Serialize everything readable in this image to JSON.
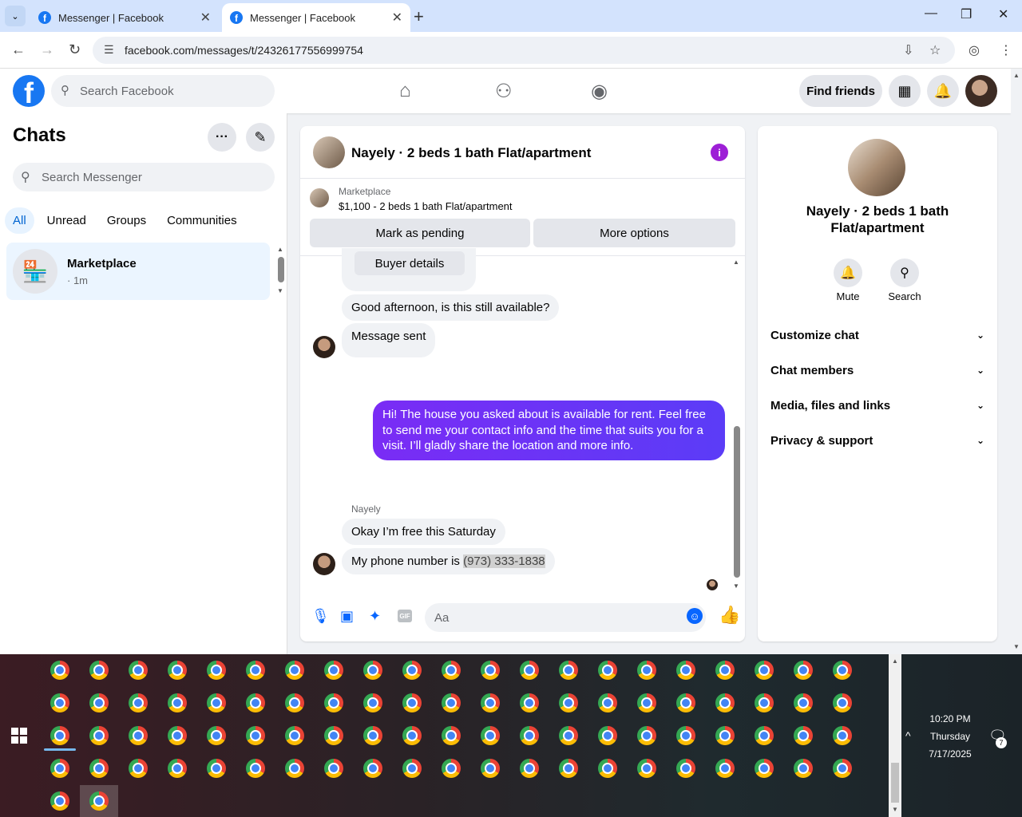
{
  "browser": {
    "tabs": [
      {
        "title": "Messenger | Facebook"
      },
      {
        "title": "Messenger | Facebook"
      }
    ],
    "url": "facebook.com/messages/t/24326177556999754"
  },
  "header": {
    "search_placeholder": "Search Facebook",
    "find_friends": "Find friends"
  },
  "chats": {
    "title": "Chats",
    "search_placeholder": "Search Messenger",
    "filters": [
      "All",
      "Unread",
      "Groups",
      "Communities"
    ],
    "conversations": [
      {
        "name": "Marketplace",
        "time": "· 1m"
      }
    ]
  },
  "conversation": {
    "name": "Nayely · 2 beds 1 bath Flat/apartment",
    "marketplace_label": "Marketplace",
    "listing": "$1,100 - 2 beds 1 bath Flat/apartment",
    "mark_pending": "Mark as pending",
    "more_options": "More options",
    "buyer_details": "Buyer details",
    "messages": {
      "m1": "Good afternoon, is this still available?",
      "m2": "Message sent",
      "out1": "Hi! The house you asked about is available for rent. Feel free to send me your contact info and the time that suits you for a visit. I’ll gladly share the location and more info.",
      "sender": "Nayely",
      "m3": "Okay I’m free this Saturday",
      "m4_prefix": "My phone number is ",
      "m4_phone": "(973) 333-1838"
    },
    "composer_placeholder": "Aa",
    "gif_label": "GIF"
  },
  "info_panel": {
    "name": "Nayely · 2 beds 1 bath Flat/apartment",
    "mute": "Mute",
    "search": "Search",
    "sections": [
      "Customize chat",
      "Chat members",
      "Media, files and links",
      "Privacy & support"
    ]
  },
  "taskbar": {
    "time": "10:20 PM",
    "day": "Thursday",
    "date": "7/17/2025",
    "notification_count": "7"
  },
  "colors": {
    "accent": "#0866ff",
    "outgoing_bubble": "#6a2ef6",
    "info_icon": "#9d1fd6"
  }
}
